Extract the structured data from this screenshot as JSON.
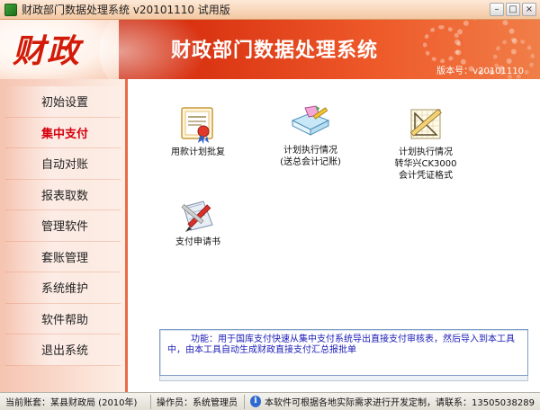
{
  "window": {
    "title": "财政部门数据处理系统 v20101110 试用版",
    "controls": {
      "minimize": "–",
      "maximize": "□",
      "close": "×"
    }
  },
  "banner": {
    "logo_text": "财政",
    "title": "财政部门数据处理系统",
    "version_label": "版本号：v20101110"
  },
  "sidebar": {
    "items": [
      {
        "label": "初始设置",
        "active": false
      },
      {
        "label": "集中支付",
        "active": true
      },
      {
        "label": "自动对账",
        "active": false
      },
      {
        "label": "报表取数",
        "active": false
      },
      {
        "label": "管理软件",
        "active": false
      },
      {
        "label": "套账管理",
        "active": false
      },
      {
        "label": "系统维护",
        "active": false
      },
      {
        "label": "软件帮助",
        "active": false
      },
      {
        "label": "退出系统",
        "active": false
      }
    ]
  },
  "tools": [
    {
      "label_lines": [
        "用款计划批复"
      ],
      "icon": "certificate-icon"
    },
    {
      "label_lines": [
        "计划执行情况",
        "(送总会计记账)"
      ],
      "icon": "book-pencil-icon"
    },
    {
      "label_lines": [
        "计划执行情况",
        "转华兴CK3000",
        "会计凭证格式"
      ],
      "icon": "ruler-triangle-icon"
    },
    {
      "label_lines": [
        "支付申请书"
      ],
      "icon": "pen-paper-icon"
    }
  ],
  "info": {
    "text": "功能：用于国库支付快速从集中支付系统导出直接支付审核表，然后导入到本工具中，由本工具自动生成财政直接支付汇总报批单"
  },
  "statusbar": {
    "account": "当前账套：某县财政局 (2010年)",
    "operator": "操作员：系统管理员",
    "notice": "本软件可根据各地实际需求进行开发定制，请联系：13505038289"
  },
  "colors": {
    "accent_red": "#d4000e",
    "banner_red": "#d93211",
    "info_text": "#1a1ab8"
  }
}
